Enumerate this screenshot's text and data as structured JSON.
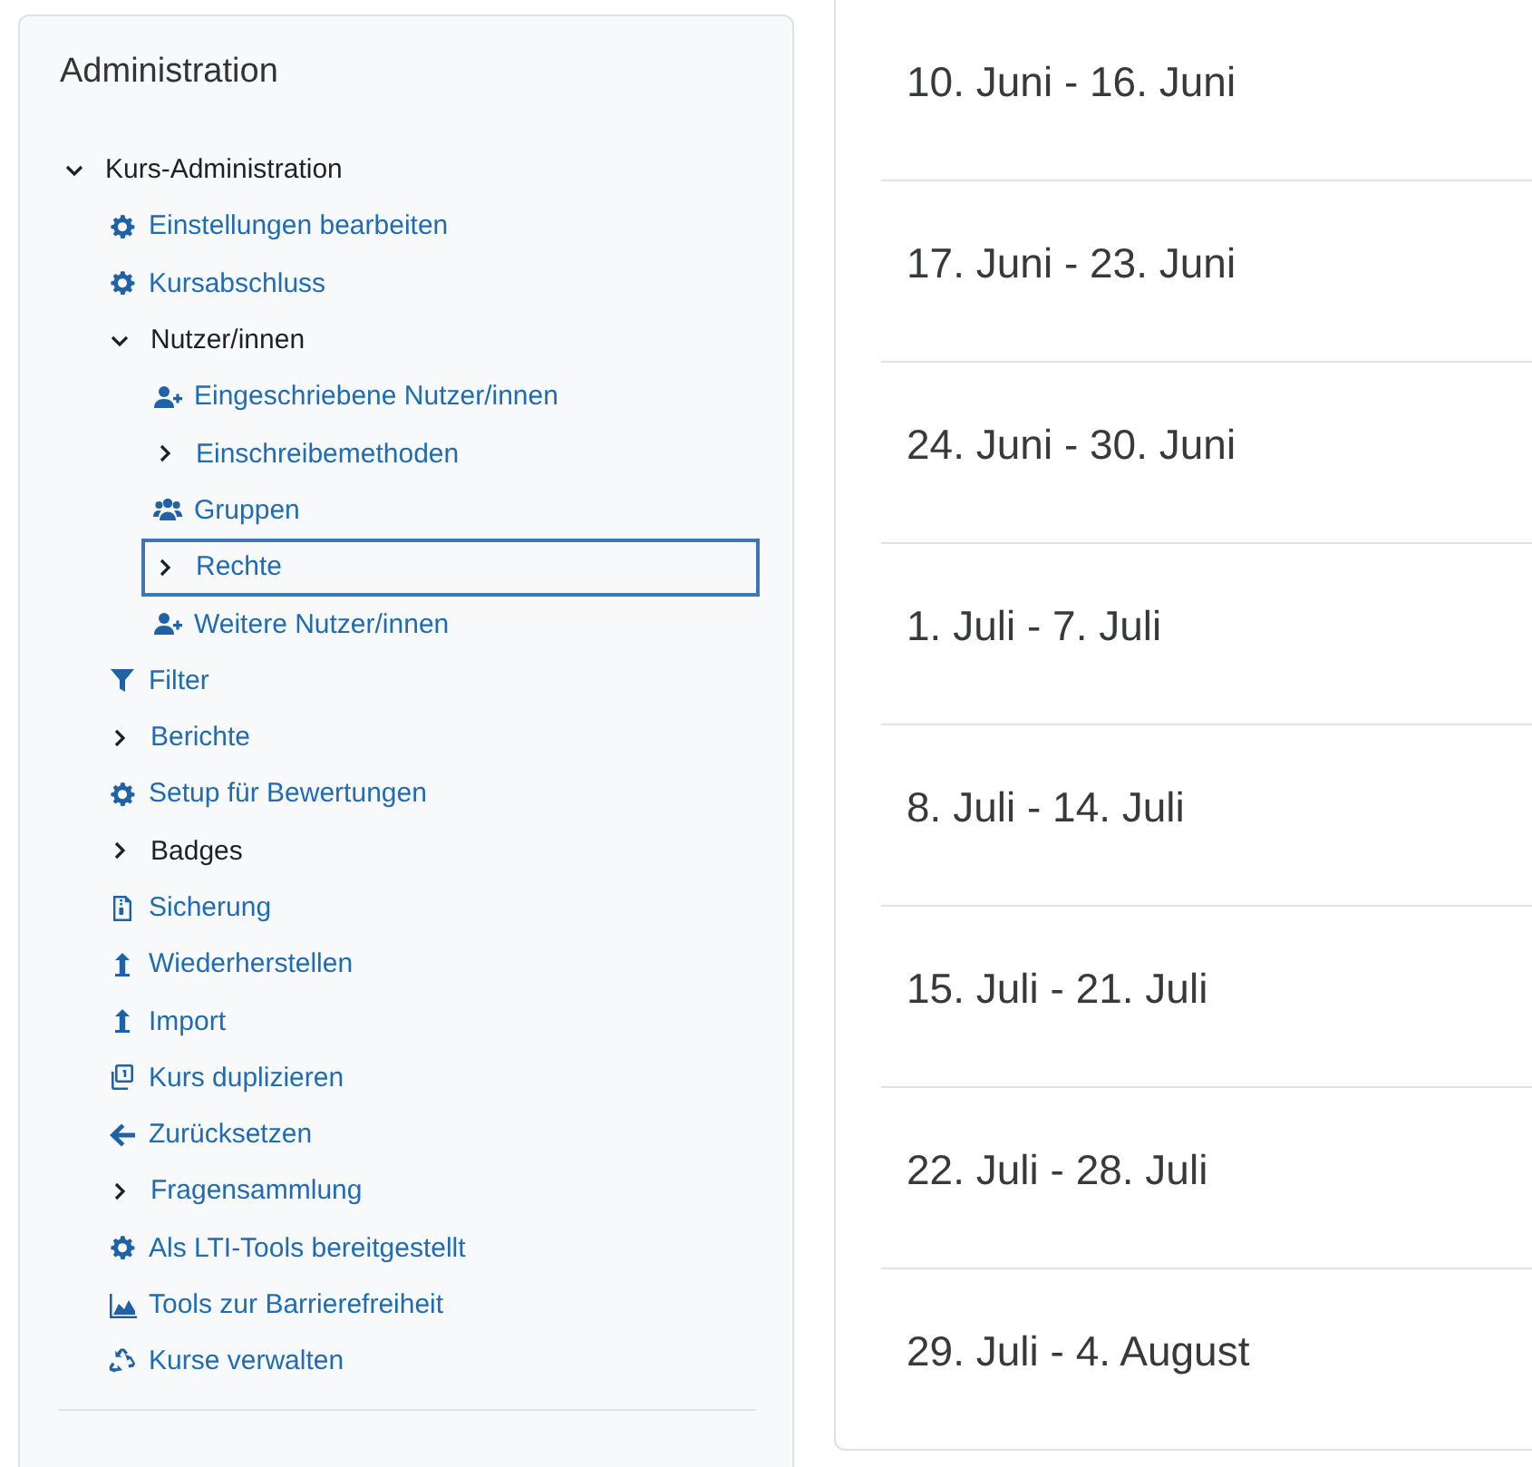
{
  "admin": {
    "title": "Administration",
    "tree": [
      {
        "label": "Kurs-Administration",
        "kind": "branch",
        "link": false,
        "expanded": true,
        "selected": false,
        "children": [
          {
            "label": "Einstellungen bearbeiten",
            "kind": "settings",
            "link": true,
            "selected": false
          },
          {
            "label": "Kursabschluss",
            "kind": "settings",
            "link": true,
            "selected": false
          },
          {
            "label": "Nutzer/innen",
            "kind": "branch",
            "link": false,
            "expanded": true,
            "selected": false,
            "children": [
              {
                "label": "Eingeschriebene Nutzer/innen",
                "kind": "user-add",
                "link": true,
                "selected": false
              },
              {
                "label": "Einschreibemethoden",
                "kind": "branch",
                "link": true,
                "expanded": false,
                "selected": false
              },
              {
                "label": "Gruppen",
                "kind": "users",
                "link": true,
                "selected": false
              },
              {
                "label": "Rechte",
                "kind": "branch",
                "link": true,
                "expanded": false,
                "selected": true
              },
              {
                "label": "Weitere Nutzer/innen",
                "kind": "user-add",
                "link": true,
                "selected": false
              }
            ]
          },
          {
            "label": "Filter",
            "kind": "filter",
            "link": true,
            "selected": false
          },
          {
            "label": "Berichte",
            "kind": "branch",
            "link": true,
            "expanded": false,
            "selected": false
          },
          {
            "label": "Setup für Bewertungen",
            "kind": "settings",
            "link": true,
            "selected": false
          },
          {
            "label": "Badges",
            "kind": "branch",
            "link": false,
            "expanded": false,
            "selected": false
          },
          {
            "label": "Sicherung",
            "kind": "archive",
            "link": true,
            "selected": false
          },
          {
            "label": "Wiederherstellen",
            "kind": "upload",
            "link": true,
            "selected": false
          },
          {
            "label": "Import",
            "kind": "upload",
            "link": true,
            "selected": false
          },
          {
            "label": "Kurs duplizieren",
            "kind": "copy",
            "link": true,
            "selected": false
          },
          {
            "label": "Zurücksetzen",
            "kind": "back",
            "link": true,
            "selected": false
          },
          {
            "label": "Fragensammlung",
            "kind": "branch",
            "link": true,
            "expanded": false,
            "selected": false
          },
          {
            "label": "Als LTI-Tools bereitgestellt",
            "kind": "settings",
            "link": true,
            "selected": false
          },
          {
            "label": "Tools zur Barrierefreiheit",
            "kind": "chart",
            "link": true,
            "selected": false
          },
          {
            "label": "Kurse verwalten",
            "kind": "recycle",
            "link": true,
            "selected": false
          }
        ]
      }
    ]
  },
  "weeks": [
    "10. Juni - 16. Juni",
    "17. Juni - 23. Juni",
    "24. Juni - 30. Juni",
    "1. Juli - 7. Juli",
    "8. Juli - 14. Juli",
    "15. Juli - 21. Juli",
    "22. Juli - 28. Juli",
    "29. Juli - 4. August"
  ]
}
